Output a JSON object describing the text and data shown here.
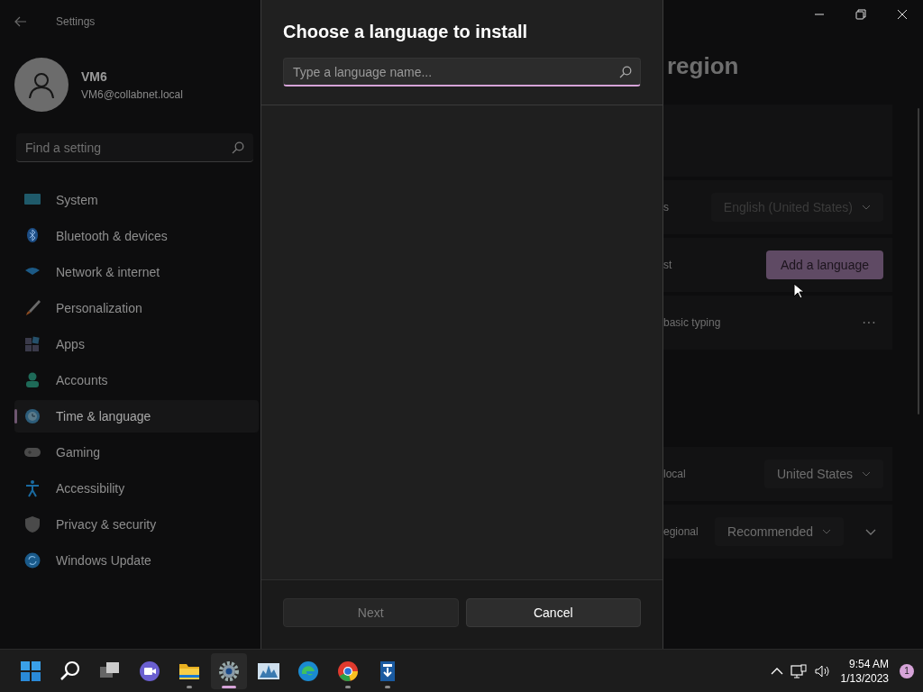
{
  "window": {
    "title": "Settings"
  },
  "account": {
    "name": "VM6",
    "email": "VM6@collabnet.local"
  },
  "search": {
    "placeholder": "Find a setting"
  },
  "sidebar": {
    "items": [
      {
        "label": "System",
        "selected": false
      },
      {
        "label": "Bluetooth & devices",
        "selected": false
      },
      {
        "label": "Network & internet",
        "selected": false
      },
      {
        "label": "Personalization",
        "selected": false
      },
      {
        "label": "Apps",
        "selected": false
      },
      {
        "label": "Accounts",
        "selected": false
      },
      {
        "label": "Time & language",
        "selected": true
      },
      {
        "label": "Gaming",
        "selected": false
      },
      {
        "label": "Accessibility",
        "selected": false
      },
      {
        "label": "Privacy & security",
        "selected": false
      },
      {
        "label": "Windows Update",
        "selected": false
      }
    ]
  },
  "page": {
    "heading": "region",
    "rows": [
      {
        "kind": "blank"
      },
      {
        "kind": "dropdown",
        "label": "s",
        "value": "English (United States)",
        "disabled": true
      },
      {
        "kind": "button",
        "label": "st",
        "value": "Add a language"
      },
      {
        "kind": "more",
        "label": "basic typing",
        "value": "···"
      },
      {
        "kind": "gap"
      },
      {
        "kind": "dropdown",
        "label": "local",
        "value": "United States",
        "disabled": false
      },
      {
        "kind": "dropdown",
        "label": "egional",
        "value": "Recommended",
        "disabled": false,
        "expander": true
      }
    ]
  },
  "dialog": {
    "title": "Choose a language to install",
    "search": {
      "placeholder": "Type a language name..."
    },
    "buttons": [
      {
        "label": "Next",
        "disabled": true
      },
      {
        "label": "Cancel",
        "disabled": false
      }
    ]
  },
  "taskbar": {
    "apps": [
      {
        "running": false,
        "selected": false
      },
      {
        "running": false,
        "selected": false
      },
      {
        "running": false,
        "selected": false
      },
      {
        "running": false,
        "selected": false
      },
      {
        "running": true,
        "selected": false
      },
      {
        "running": true,
        "selected": true
      },
      {
        "running": false,
        "selected": false
      },
      {
        "running": false,
        "selected": false
      },
      {
        "running": true,
        "selected": false
      },
      {
        "running": true,
        "selected": false
      }
    ],
    "time": "9:54 AM",
    "date": "1/13/2023",
    "notifications": "1"
  }
}
